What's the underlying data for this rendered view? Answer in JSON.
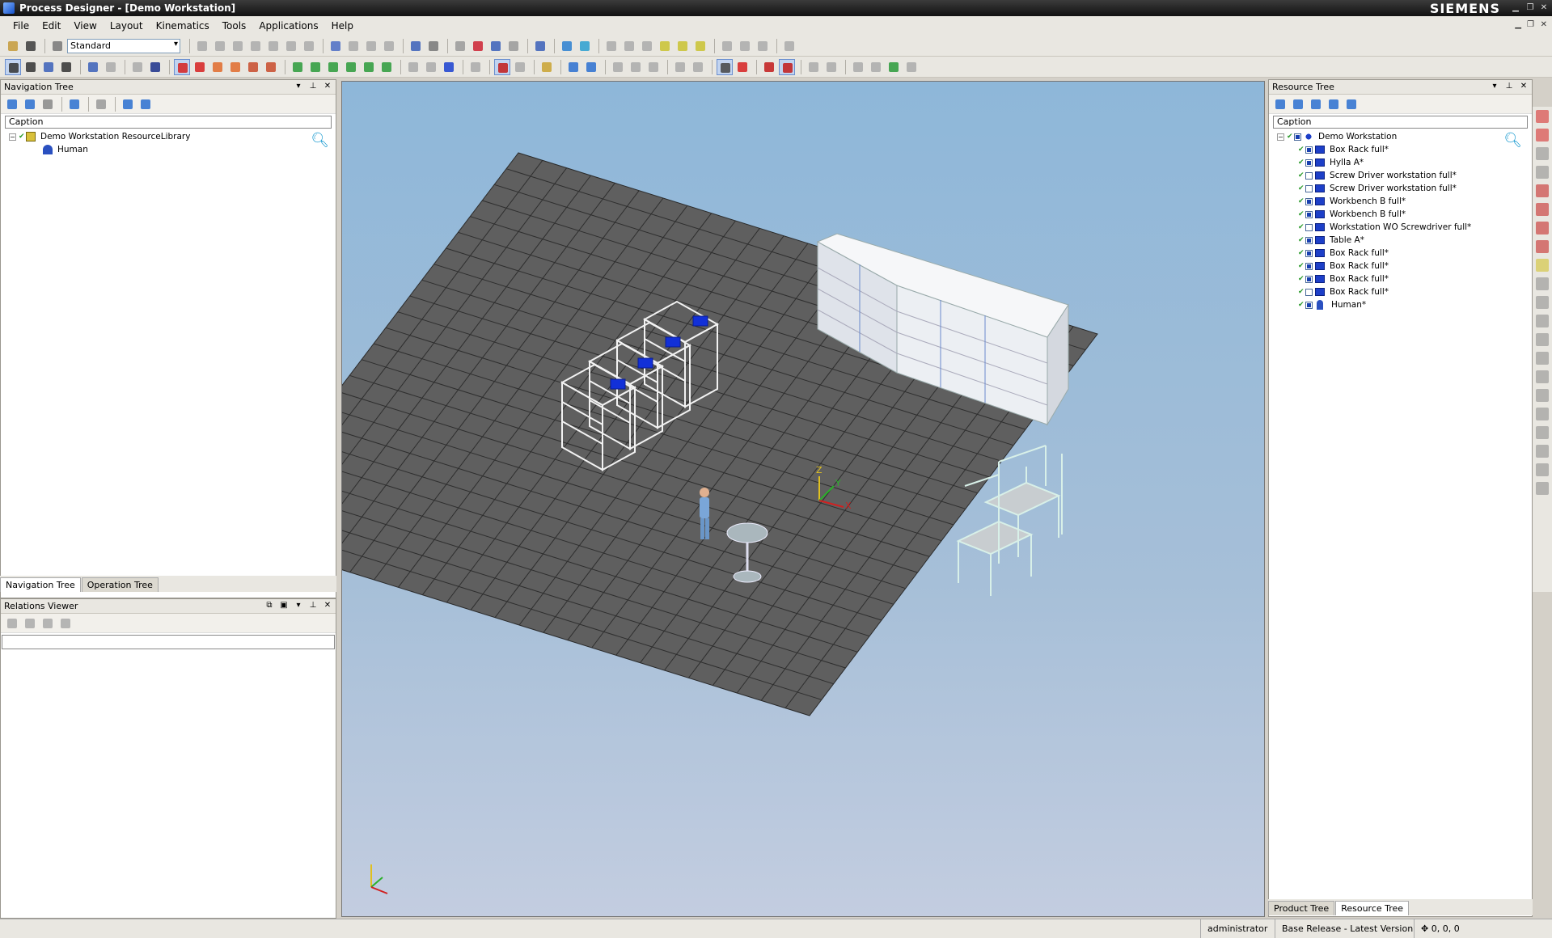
{
  "window": {
    "title": "Process Designer - [Demo Workstation]",
    "brand": "SIEMENS"
  },
  "menu": [
    "File",
    "Edit",
    "View",
    "Layout",
    "Kinematics",
    "Tools",
    "Applications",
    "Help"
  ],
  "toolbar": {
    "layout_combo": "Standard"
  },
  "navigation_tree": {
    "title": "Navigation Tree",
    "caption_header": "Caption",
    "root": "Demo Workstation ResourceLibrary",
    "child": "Human",
    "tabs": [
      "Navigation Tree",
      "Operation Tree"
    ]
  },
  "relations_viewer": {
    "title": "Relations Viewer"
  },
  "resource_tree": {
    "title": "Resource Tree",
    "caption_header": "Caption",
    "root": "Demo Workstation",
    "items": [
      {
        "label": "Box Rack full*",
        "checked": true,
        "icon": "resource-icon"
      },
      {
        "label": "Hylla A*",
        "checked": true,
        "icon": "resource-icon"
      },
      {
        "label": "Screw Driver workstation full*",
        "checked": false,
        "icon": "resource-icon"
      },
      {
        "label": "Screw Driver workstation full*",
        "checked": false,
        "icon": "resource-icon"
      },
      {
        "label": "Workbench B full*",
        "checked": true,
        "icon": "resource-icon"
      },
      {
        "label": "Workbench B full*",
        "checked": true,
        "icon": "resource-icon"
      },
      {
        "label": "Workstation WO Screwdriver full*",
        "checked": false,
        "icon": "resource-icon"
      },
      {
        "label": "Table A*",
        "checked": true,
        "icon": "resource-icon"
      },
      {
        "label": "Box Rack full*",
        "checked": true,
        "icon": "resource-icon"
      },
      {
        "label": "Box Rack full*",
        "checked": true,
        "icon": "resource-icon"
      },
      {
        "label": "Box Rack full*",
        "checked": true,
        "icon": "resource-icon"
      },
      {
        "label": "Box Rack full*",
        "checked": false,
        "icon": "resource-icon"
      },
      {
        "label": "Human*",
        "checked": true,
        "icon": "human-icon"
      }
    ],
    "tabs": [
      "Product Tree",
      "Resource Tree"
    ]
  },
  "viewport": {
    "axis_labels": {
      "x": "X",
      "y": "Y",
      "z": "Z"
    }
  },
  "status": {
    "user": "administrator",
    "release": "Base Release - Latest Version",
    "coords": "0, 0, 0"
  },
  "colors": {
    "title_bar": "#1a1a1a",
    "floor": "#5f5f5f",
    "sky": "#9bbad9",
    "resource_blue": "#1d3fc8"
  }
}
